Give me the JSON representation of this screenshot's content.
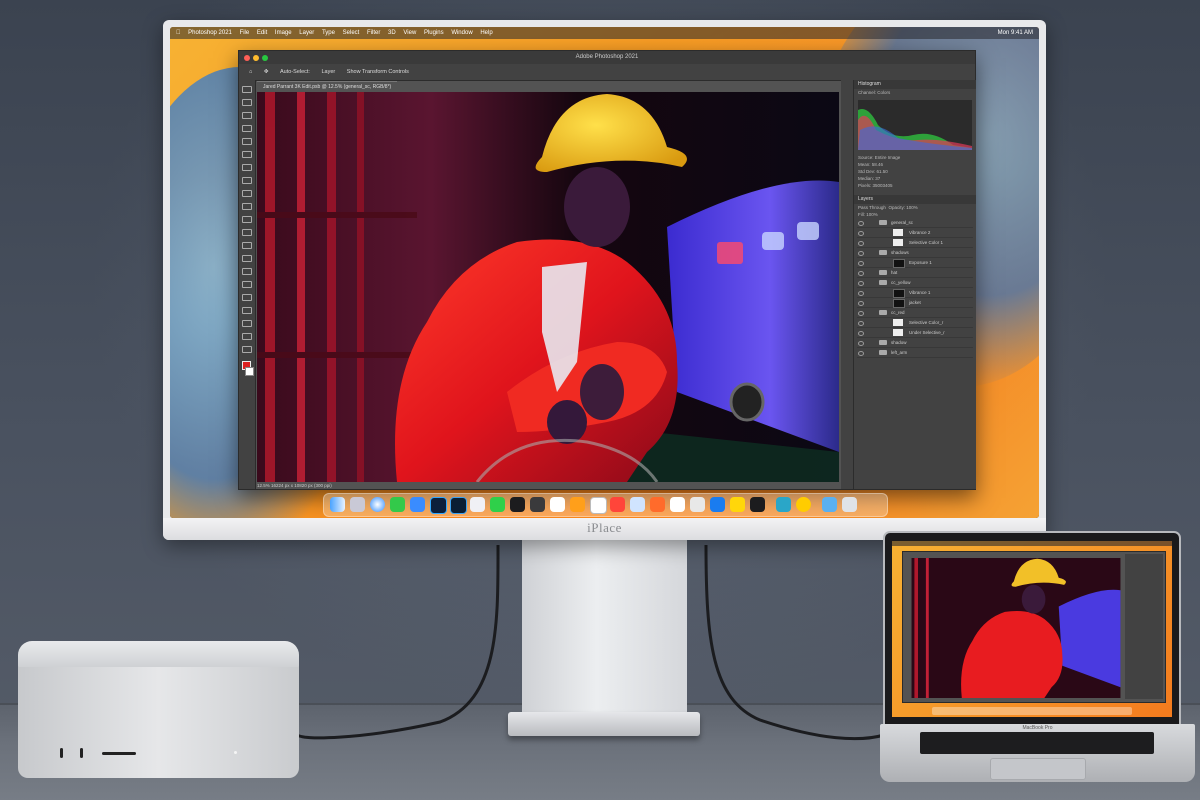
{
  "monitor": {
    "brand": "iPlace",
    "menubar_left": [
      "Photoshop 2021",
      "File",
      "Edit",
      "Image",
      "Layer",
      "Type",
      "Select",
      "Filter",
      "3D",
      "View",
      "Plugins",
      "Window",
      "Help"
    ],
    "menubar_right": "Mon 9:41 AM"
  },
  "photoshop": {
    "window_title": "Adobe Photoshop 2021",
    "options": [
      "Auto-Select:",
      "Layer",
      "Show Transform Controls"
    ],
    "doc_tab": "Jared Parrant 3K Edit.psb @ 12.5% (general_sc, RGB/8*)",
    "status": "12.5%   16224 px x 10820 px (300 ppi)",
    "panels": {
      "histogram": "Histogram",
      "channel_label": "Channel:",
      "channel_value": "Colors",
      "source_label": "Source:",
      "source_value": "Entire Image",
      "stats": [
        "Mean: 58.46",
        "Std Dev: 61.50",
        "Median: 37",
        "Pixels: 35003405"
      ],
      "layers": "Layers",
      "blend_mode": "Pass Through",
      "opacity": "Opacity: 100%",
      "fill": "Fill: 100%",
      "layer_rows": [
        {
          "name": "general_sc",
          "thumb": "none"
        },
        {
          "name": "Vibrance 2",
          "thumb": "light"
        },
        {
          "name": "Selective Color 1",
          "thumb": "light"
        },
        {
          "name": "shadows",
          "thumb": "none"
        },
        {
          "name": "Exposure 1",
          "thumb": "dark"
        },
        {
          "name": "hat",
          "thumb": "none"
        },
        {
          "name": "cc_yellow",
          "thumb": "none"
        },
        {
          "name": "Vibrance 1",
          "thumb": "dark"
        },
        {
          "name": "jacket",
          "thumb": "dark"
        },
        {
          "name": "cc_red",
          "thumb": "none"
        },
        {
          "name": "Selective Color_r",
          "thumb": "light"
        },
        {
          "name": "Under Selective_r",
          "thumb": "light"
        },
        {
          "name": "shadow",
          "thumb": "none"
        },
        {
          "name": "left_arm",
          "thumb": "none"
        }
      ]
    }
  },
  "laptop": {
    "label": "MacBook Pro"
  }
}
